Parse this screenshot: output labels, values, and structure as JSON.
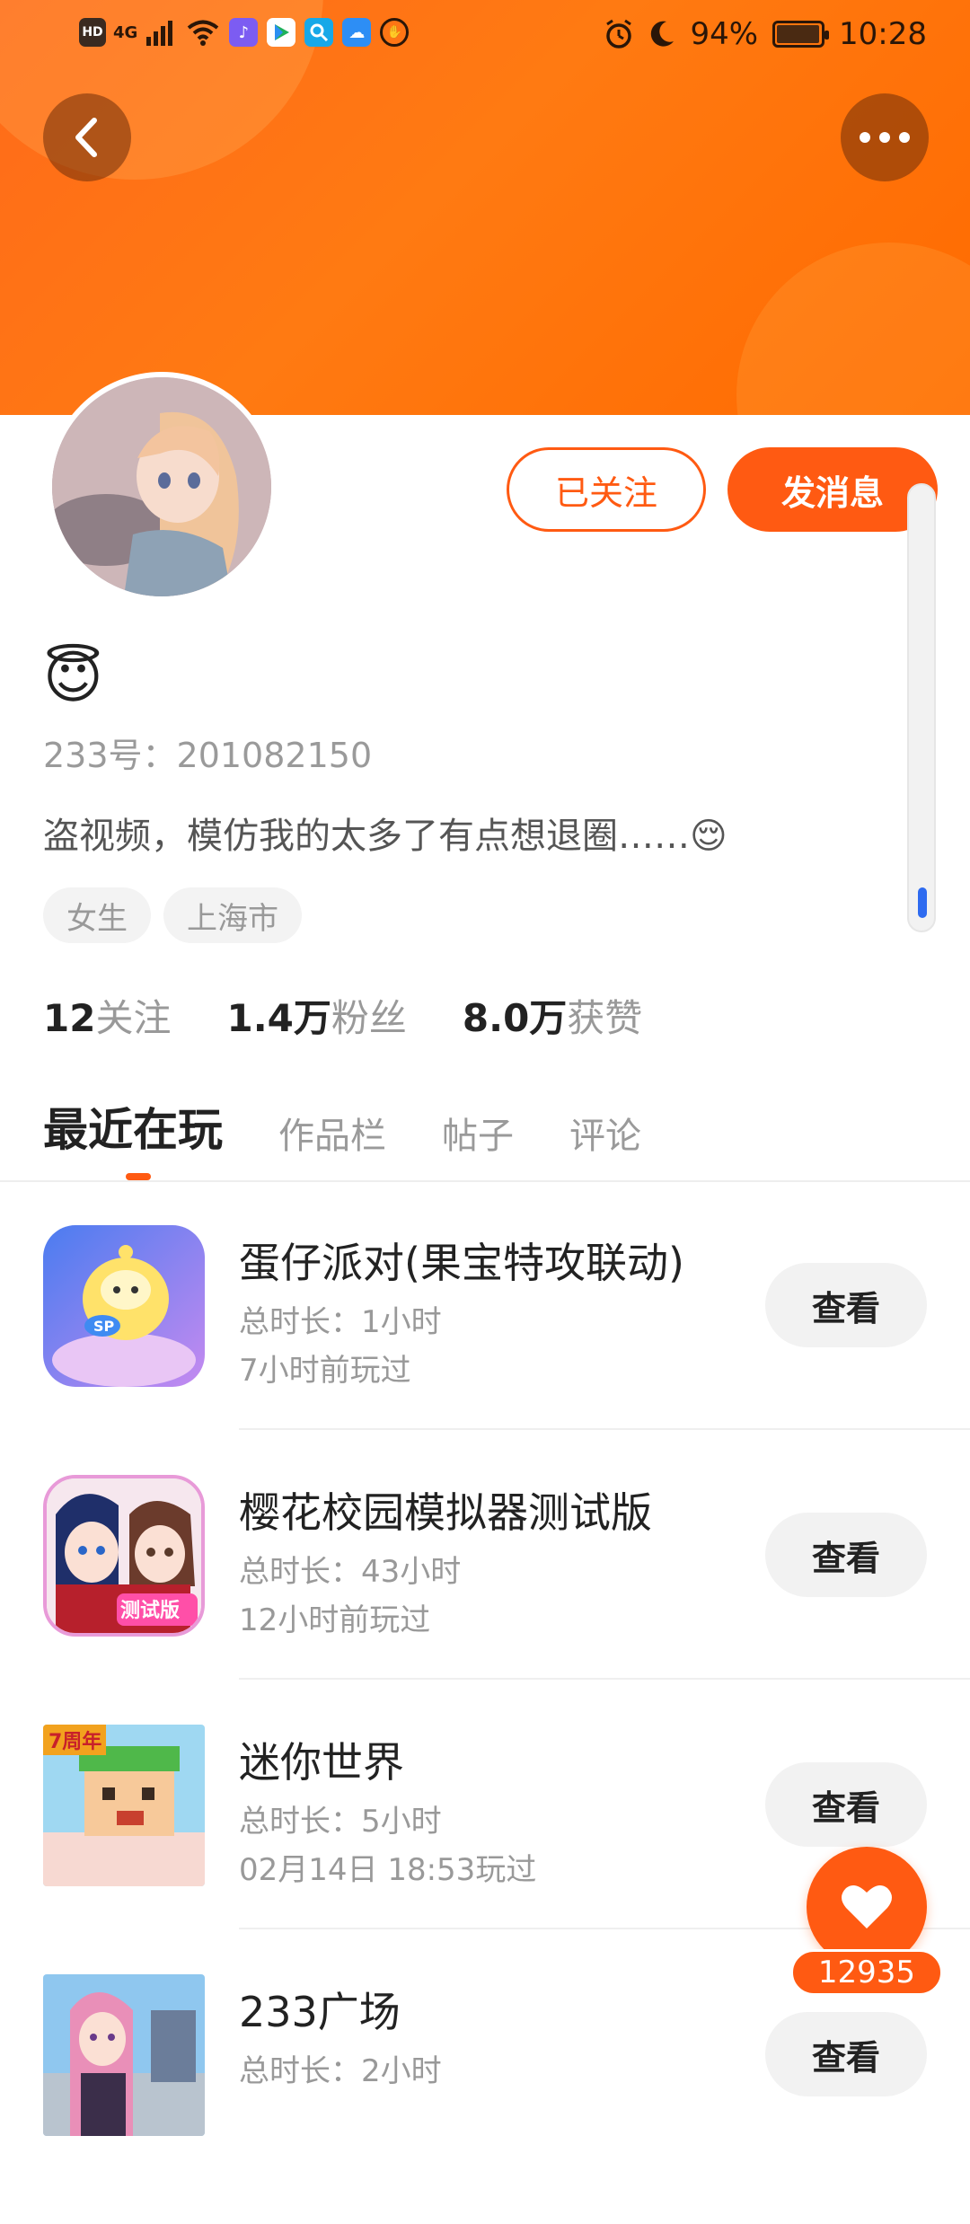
{
  "status_bar": {
    "network_label": "4G",
    "battery_percent": "94%",
    "battery_level": 0.94,
    "time": "10:28",
    "icons": [
      "hd-icon",
      "signal-icon",
      "wifi-icon",
      "music-app-icon",
      "play-store-icon",
      "search-app-icon",
      "weather-app-icon",
      "shield-app-icon",
      "alarm-icon",
      "moon-icon",
      "battery-icon"
    ]
  },
  "header": {
    "back_icon": "chevron-left-icon",
    "more_icon": "more-dots-icon"
  },
  "profile": {
    "followed_label": "已关注",
    "message_label": "发消息",
    "nickname_emoji": "😇",
    "uid": "233号：201082150",
    "bio": "盗视频，模仿我的太多了有点想退圈……😌",
    "tags": [
      "女生",
      "上海市"
    ],
    "stats": [
      {
        "num": "12",
        "label": "关注"
      },
      {
        "num": "1.4万",
        "label": "粉丝"
      },
      {
        "num": "8.0万",
        "label": "获赞"
      }
    ]
  },
  "tabs": [
    {
      "label": "最近在玩",
      "active": true
    },
    {
      "label": "作品栏",
      "active": false
    },
    {
      "label": "帖子",
      "active": false
    },
    {
      "label": "评论",
      "active": false
    }
  ],
  "games": [
    {
      "name": "蛋仔派对(果宝特攻联动)",
      "duration": "总时长：1小时",
      "last_played": "7小时前玩过",
      "button": "查看"
    },
    {
      "name": "樱花校园模拟器测试版",
      "duration": "总时长：43小时",
      "last_played": "12小时前玩过",
      "button": "查看"
    },
    {
      "name": "迷你世界",
      "duration": "总时长：5小时",
      "last_played": "02月14日 18:53玩过",
      "button": "查看"
    },
    {
      "name": "233广场",
      "duration": "总时长：2小时",
      "last_played": "",
      "button": "查看"
    }
  ],
  "game_icon_texts": {
    "eggy_badge": "SP",
    "sakura_badge": "测试版",
    "mini_badge": "7周年"
  },
  "like_fab": {
    "icon": "heart-icon",
    "count": "12935"
  },
  "colors": {
    "accent": "#ff5a12",
    "banner": "#ff7a12"
  }
}
